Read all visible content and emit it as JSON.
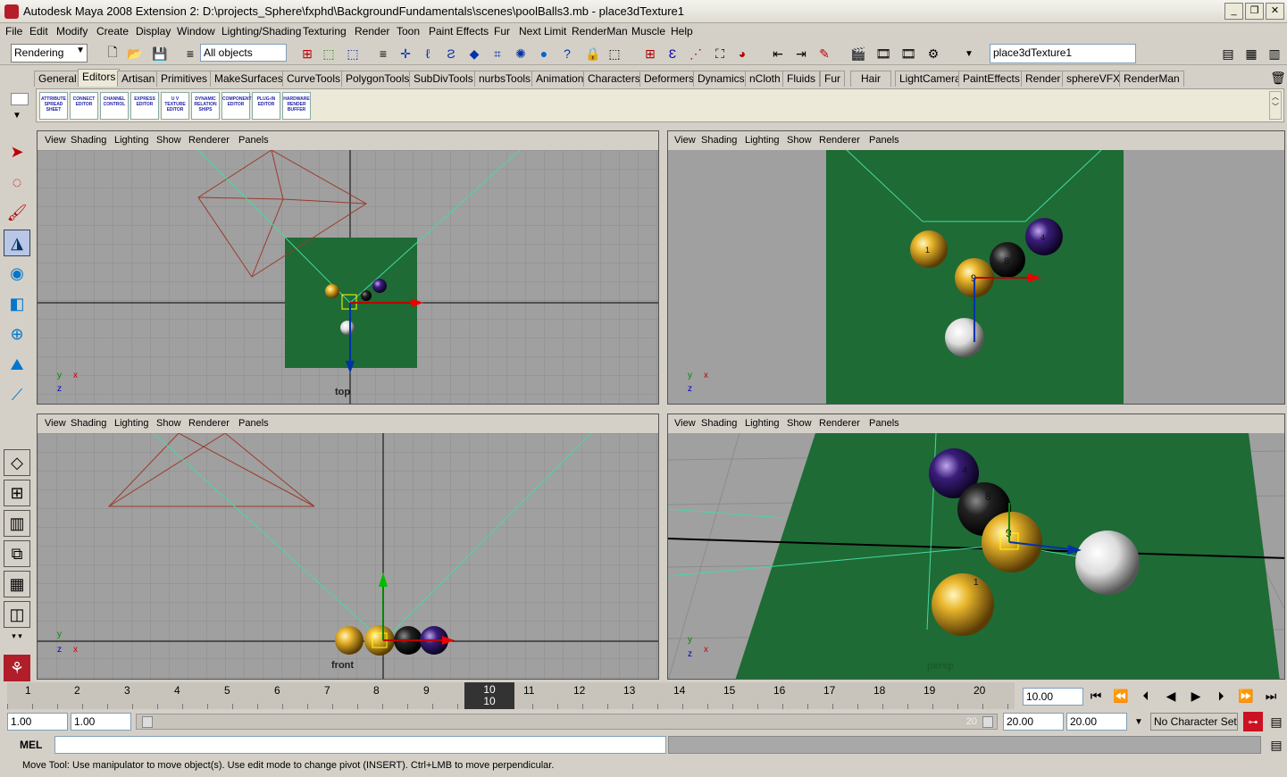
{
  "window": {
    "title": "Autodesk Maya 2008 Extension 2: D:\\projects_Sphere\\fxphd\\BackgroundFundamentals\\scenes\\poolBalls3.mb    -    place3dTexture1"
  },
  "menu": [
    "File",
    "Edit",
    "Modify",
    "Create",
    "Display",
    "Window",
    "Lighting/Shading",
    "Texturing",
    "Render",
    "Toon",
    "Paint Effects",
    "Fur",
    "Next Limit",
    "RenderMan",
    "Muscle",
    "Help"
  ],
  "status": {
    "mode": "Rendering",
    "selection_mask": "All objects",
    "name_field": "place3dTexture1"
  },
  "shelf_tabs": [
    "General",
    "Editors",
    "Artisan",
    "Primitives",
    "MakeSurfaces",
    "CurveTools",
    "PolygonTools",
    "SubDivTools",
    "nurbsTools",
    "Animation",
    "Characters",
    "Deformers",
    "Dynamics",
    "nCloth",
    "Fluids",
    "Fur",
    "Hair",
    "LightCamera",
    "PaintEffects",
    "Render",
    "sphereVFX",
    "RenderMan"
  ],
  "shelf_active": "Editors",
  "shelf_buttons": [
    "ATTRIBUTE SPREAD SHEET",
    "CONNECT EDITOR",
    "CHANNEL CONTROL",
    "EXPRESS EDITOR",
    "U V TEXTURE EDITOR",
    "DYNAMIC RELATION SHIPS",
    "COMPONENT EDITOR",
    "PLUG-IN EDITOR",
    "HARDWARE RENDER BUFFER"
  ],
  "panel_menu": [
    "View",
    "Shading",
    "Lighting",
    "Show",
    "Renderer",
    "Panels"
  ],
  "viewports": {
    "top": "top",
    "front": "front",
    "persp": "persp"
  },
  "ball_numbers": {
    "one": "1",
    "eight": "8",
    "nine": "9",
    "four": "4"
  },
  "axis": {
    "x": "x",
    "y": "y",
    "z": "z"
  },
  "timeline": {
    "ticks": [
      "1",
      "2",
      "3",
      "4",
      "5",
      "6",
      "7",
      "8",
      "9",
      "10",
      "11",
      "12",
      "13",
      "14",
      "15",
      "16",
      "17",
      "18",
      "19",
      "20"
    ],
    "current": "10",
    "current_field": "10.00"
  },
  "range": {
    "start": "1.00",
    "start2": "1.00",
    "end": "20.00",
    "end2": "20.00",
    "slider_end": "20",
    "char_set": "No Character Set"
  },
  "cmd": {
    "label": "MEL"
  },
  "help": "Move Tool: Use manipulator to move object(s). Use edit mode to change pivot (INSERT).  Ctrl+LMB to move perpendicular.",
  "colors": {
    "felt": "#1e6b35",
    "grid": "#8c8c8c",
    "axis": "#000000",
    "camera": "#9c3a2a",
    "frustum": "#47d9a0"
  }
}
